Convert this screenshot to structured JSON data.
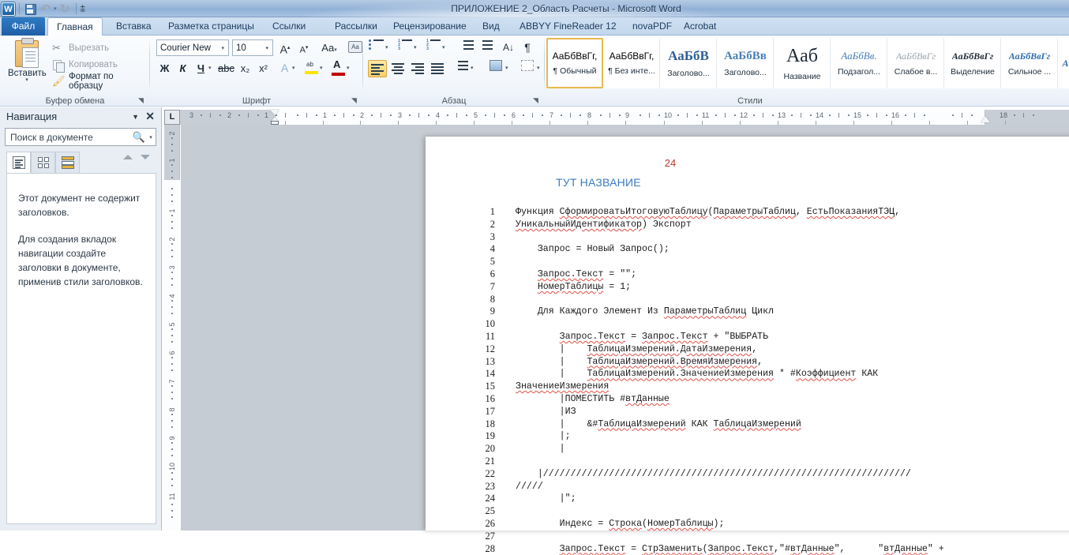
{
  "titlebar": {
    "document_title": "ПРИЛОЖЕНИЕ 2_Область Расчеты  -  Microsoft Word",
    "app_logo": "word-logo",
    "quick_access": [
      {
        "name": "save-icon",
        "label": "\u0000"
      },
      {
        "name": "undo-icon",
        "glyph": "↶"
      },
      {
        "name": "redo-icon",
        "glyph": "↻"
      },
      {
        "name": "customize-qat-icon",
        "glyph": "▾"
      }
    ]
  },
  "tabs": {
    "file": "Файл",
    "items": [
      {
        "label": "Главная",
        "active": true
      },
      {
        "label": "Вставка",
        "active": false
      },
      {
        "label": "Разметка страницы",
        "active": false
      },
      {
        "label": "Ссылки",
        "active": false
      },
      {
        "label": "Рассылки",
        "active": false
      },
      {
        "label": "Рецензирование",
        "active": false
      },
      {
        "label": "Вид",
        "active": false
      },
      {
        "label": "ABBYY FineReader 12",
        "active": false
      },
      {
        "label": "novaPDF",
        "active": false
      },
      {
        "label": "Acrobat",
        "active": false
      }
    ]
  },
  "ribbon": {
    "clipboard": {
      "group_label": "Буфер обмена",
      "paste_label": "Вставить",
      "cut_label": "Вырезать",
      "copy_label": "Копировать",
      "format_painter_label": "Формат по образцу"
    },
    "font": {
      "group_label": "Шрифт",
      "font_name": "Courier New",
      "font_size": "10",
      "grow_label": "A",
      "shrink_label": "A",
      "change_case_label": "Aa",
      "bold_label": "Ж",
      "italic_label": "К",
      "underline_label": "Ч",
      "strike_label": "abc",
      "subscript_label": "x₂",
      "superscript_label": "x²",
      "text_effect_label": "A",
      "highlight_label": "ab",
      "font_color_label": "A",
      "highlight_color": "#ffe400",
      "font_color": "#c00000"
    },
    "paragraph": {
      "group_label": "Абзац",
      "marks_label": "¶",
      "sort_label": "А↓"
    },
    "styles": {
      "group_label": "Стили",
      "items": [
        {
          "preview": "АаБбВвГг,",
          "name": "¶ Обычный",
          "selected": true,
          "style": "normal"
        },
        {
          "preview": "АаБбВвГг,",
          "name": "¶ Без инте...",
          "selected": false,
          "style": "normal"
        },
        {
          "preview": "АаБбВ",
          "name": "Заголово...",
          "selected": false,
          "style": "h1"
        },
        {
          "preview": "АаБбВв",
          "name": "Заголово...",
          "selected": false,
          "style": "h2"
        },
        {
          "preview": "Ааб",
          "name": "Название",
          "selected": false,
          "style": "title"
        },
        {
          "preview": "АаБбВв.",
          "name": "Подзагол...",
          "selected": false,
          "style": "subtitle"
        },
        {
          "preview": "АаБбВвГг",
          "name": "Слабое в...",
          "selected": false,
          "style": "weak"
        },
        {
          "preview": "АаБбВвГг",
          "name": "Выделение",
          "selected": false,
          "style": "emphasis"
        },
        {
          "preview": "АаБбВвГг",
          "name": "Сильное ...",
          "selected": false,
          "style": "strong"
        },
        {
          "preview": "А",
          "name": "",
          "selected": false,
          "style": "more"
        }
      ]
    }
  },
  "navigation": {
    "title": "Навигация",
    "search_placeholder": "Поиск в документе",
    "search_value": "",
    "tabs": [
      {
        "name": "headings-tab",
        "active": true
      },
      {
        "name": "pages-tab",
        "active": false
      },
      {
        "name": "results-tab",
        "active": false
      }
    ],
    "body_paragraphs": [
      "Этот документ не содержит заголовков.",
      "Для создания вкладок навигации создайте заголовки в документе, применив стили заголовков."
    ]
  },
  "ruler": {
    "corner_tab_stop": "L",
    "horizontal_labels": [
      "3",
      "2",
      "1",
      "1",
      "2",
      "3",
      "4",
      "5",
      "6",
      "7",
      "8",
      "9",
      "10",
      "11",
      "12",
      "13",
      "14",
      "15",
      "16",
      "18"
    ],
    "vertical_labels": [
      "2",
      "1",
      "1",
      "2",
      "3",
      "4",
      "5",
      "6",
      "7",
      "8",
      "9",
      "10",
      "11"
    ]
  },
  "document": {
    "page_number": "24",
    "heading": "ТУТ НАЗВАНИЕ",
    "code_lines": [
      {
        "n": "1",
        "text": "Функция СформироватьИтоговуюТаблицу(ПараметрыТаблиц, ЕстьПоказанияТЭЦ,"
      },
      {
        "n": "2",
        "text": "УникальныйИдентификатор) Экспорт"
      },
      {
        "n": "3",
        "text": ""
      },
      {
        "n": "4",
        "text": "    Запрос = Новый Запрос();"
      },
      {
        "n": "5",
        "text": ""
      },
      {
        "n": "6",
        "text": "    Запрос.Текст = \"\";"
      },
      {
        "n": "7",
        "text": "    НомерТаблицы = 1;"
      },
      {
        "n": "8",
        "text": ""
      },
      {
        "n": "9",
        "text": "    Для Каждого Элемент Из ПараметрыТаблиц Цикл"
      },
      {
        "n": "10",
        "text": ""
      },
      {
        "n": "11",
        "text": "        Запрос.Текст = Запрос.Текст + \"ВЫБРАТЬ"
      },
      {
        "n": "12",
        "text": "        |    ТаблицаИзмерений.ДатаИзмерения,"
      },
      {
        "n": "13",
        "text": "        |    ТаблицаИзмерений.ВремяИзмерения,"
      },
      {
        "n": "14",
        "text": "        |    ТаблицаИзмерений.ЗначениеИзмерения * #Коэффициент КАК"
      },
      {
        "n": "15",
        "text": "ЗначениеИзмерения"
      },
      {
        "n": "16",
        "text": "        |ПОМЕСТИТЬ #втДанные"
      },
      {
        "n": "17",
        "text": "        |ИЗ"
      },
      {
        "n": "18",
        "text": "        |    &#ТаблицаИзмерений КАК ТаблицаИзмерений"
      },
      {
        "n": "19",
        "text": "        |;"
      },
      {
        "n": "20",
        "text": "        |"
      },
      {
        "n": "21",
        "text": ""
      },
      {
        "n": "22",
        "text": "    |///////////////////////////////////////////////////////////////////"
      },
      {
        "n": "23",
        "text": "/////"
      },
      {
        "n": "24",
        "text": "        |\";"
      },
      {
        "n": "25",
        "text": ""
      },
      {
        "n": "26",
        "text": "        Индекс = Строка(НомерТаблицы);"
      },
      {
        "n": "27",
        "text": ""
      },
      {
        "n": "28",
        "text": "        Запрос.Текст = СтрЗаменить(Запрос.Текст,\"#втДанные\",      \"втДанные\" +"
      }
    ]
  },
  "colors": {
    "accent_blue": "#2f7bc4",
    "page_number_red": "#c0392b",
    "heading_blue": "#3b7bbf",
    "spell_error_red": "#e2504a",
    "grammar_error_green": "#3faa55"
  }
}
